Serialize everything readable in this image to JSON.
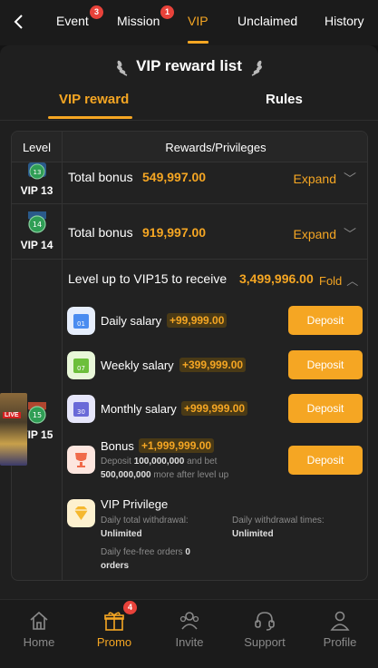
{
  "nav": {
    "tabs": [
      {
        "label": "Event",
        "badge": "3"
      },
      {
        "label": "Mission",
        "badge": "1"
      },
      {
        "label": "VIP",
        "active": true
      },
      {
        "label": "Unclaimed"
      },
      {
        "label": "History"
      }
    ]
  },
  "panel": {
    "title": "VIP reward list",
    "subtabs": [
      "VIP reward",
      "Rules"
    ]
  },
  "table": {
    "headers": {
      "level": "Level",
      "rewards": "Rewards/Privileges"
    },
    "rows": [
      {
        "level": "VIP 13",
        "badge_num": "13",
        "label": "Total bonus",
        "amount": "549,997.00",
        "action": "Expand"
      },
      {
        "level": "VIP 14",
        "badge_num": "14",
        "label": "Total bonus",
        "amount": "919,997.00",
        "action": "Expand"
      }
    ],
    "expanded": {
      "level": "VIP 15",
      "badge_num": "15",
      "header": "Level up to VIP15 to receive",
      "amount": "3,499,996.00",
      "action": "Fold",
      "items": [
        {
          "icon": "01",
          "label": "Daily salary",
          "value": "+99,999.00",
          "button": "Deposit"
        },
        {
          "icon": "07",
          "label": "Weekly salary",
          "value": "+399,999.00",
          "button": "Deposit"
        },
        {
          "icon": "30",
          "label": "Monthly salary",
          "value": "+999,999.00",
          "button": "Deposit"
        },
        {
          "label": "Bonus",
          "value": "+1,999,999.00",
          "button": "Deposit",
          "note_1": "Deposit",
          "note_deposit": "100,000,000",
          "note_2": "and bet",
          "note_bet": "500,000,000",
          "note_3": "more after level up"
        }
      ],
      "privilege": {
        "label": "VIP Privilege",
        "daily_withdrawal_label": "Daily total withdrawal:",
        "daily_withdrawal_value": "Unlimited",
        "withdrawal_times_label": "Daily withdrawal times:",
        "withdrawal_times_value": "Unlimited",
        "fee_free_label": "Daily fee-free orders",
        "fee_free_value": "0",
        "fee_free_unit": "orders"
      }
    }
  },
  "live_tag": "LIVE",
  "bottom_nav": [
    {
      "label": "Home"
    },
    {
      "label": "Promo",
      "badge": "4",
      "active": true
    },
    {
      "label": "Invite"
    },
    {
      "label": "Support"
    },
    {
      "label": "Profile"
    }
  ],
  "colors": {
    "accent": "#f5a623",
    "badge_red": "#e8423a",
    "background": "#141414"
  }
}
